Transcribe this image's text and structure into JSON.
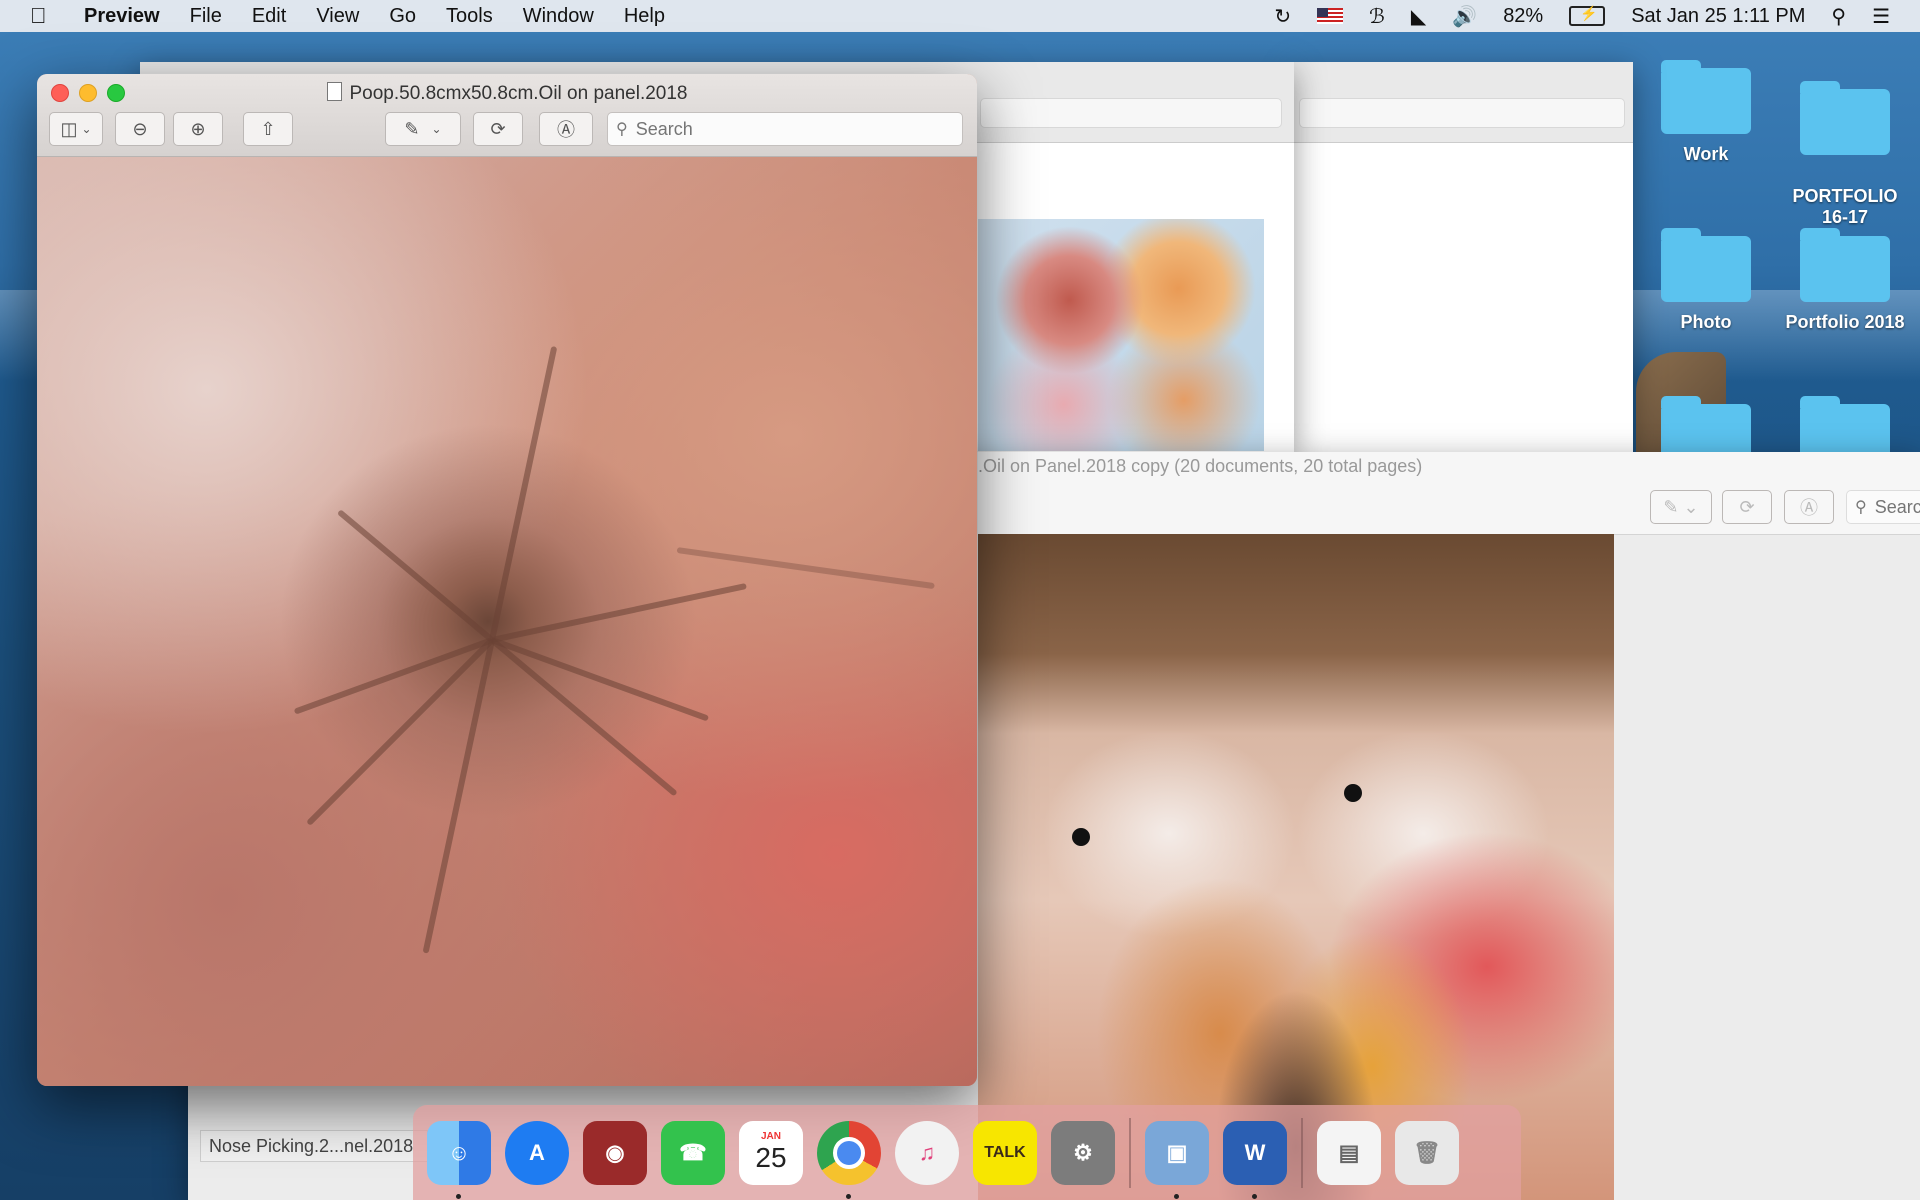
{
  "menubar": {
    "app_name": "Preview",
    "menus": [
      "File",
      "Edit",
      "View",
      "Go",
      "Tools",
      "Window",
      "Help"
    ],
    "battery": "82%",
    "clock": "Sat Jan 25  1:11 PM",
    "icons": [
      "time-machine-icon",
      "flag-icon",
      "bluetooth-icon",
      "wifi-icon",
      "volume-icon",
      "battery-icon",
      "spotlight-icon",
      "notification-center-icon"
    ]
  },
  "desktop_folders": [
    {
      "label": "Work"
    },
    {
      "label": "PORTFOLIO\n16-17"
    },
    {
      "label": "Photo"
    },
    {
      "label": "Portfolio 2018"
    }
  ],
  "preview_window": {
    "title": "Poop.50.8cmx50.8cm.Oil on panel.2018",
    "search_placeholder": "Search"
  },
  "back_window": {
    "status": ".Oil on Panel.2018 copy (20 documents, 20 total pages)",
    "search_placeholder": "Search"
  },
  "nose_label": "Nose Picking.2...nel.2018",
  "dock": {
    "apps": [
      {
        "name": "Finder",
        "icon": "finder-icon",
        "color": "#3d8ef0",
        "running": true
      },
      {
        "name": "App Store",
        "icon": "app-store-icon",
        "color": "#1e7cf2",
        "running": false
      },
      {
        "name": "Photo Booth",
        "icon": "photo-booth-icon",
        "color": "#9a2a2a",
        "running": false
      },
      {
        "name": "FaceTime",
        "icon": "facetime-icon",
        "color": "#33c24d",
        "running": false
      },
      {
        "name": "Calendar",
        "icon": "calendar-icon",
        "color": "#ffffff",
        "running": false,
        "month": "JAN",
        "day": "25"
      },
      {
        "name": "Chrome",
        "icon": "chrome-icon",
        "color": "#e8b73a",
        "running": true
      },
      {
        "name": "iTunes",
        "icon": "music-icon",
        "color": "#f2f2f2",
        "running": false
      },
      {
        "name": "KakaoTalk",
        "icon": "kakaotalk-icon",
        "color": "#f7e600",
        "running": false,
        "label": "TALK"
      },
      {
        "name": "System Preferences",
        "icon": "system-preferences-icon",
        "color": "#7c7c7c",
        "running": false
      }
    ],
    "running_docs": [
      {
        "name": "Preview",
        "icon": "preview-icon",
        "color": "#7aa7d8",
        "running": true
      },
      {
        "name": "Word",
        "icon": "word-icon",
        "color": "#2b5fb3",
        "running": true,
        "label": "W"
      }
    ],
    "trailing": [
      {
        "name": "Documents",
        "icon": "documents-stack-icon",
        "color": "#f4f4f4"
      },
      {
        "name": "Trash",
        "icon": "trash-icon",
        "color": "#e8e8e8"
      }
    ]
  }
}
